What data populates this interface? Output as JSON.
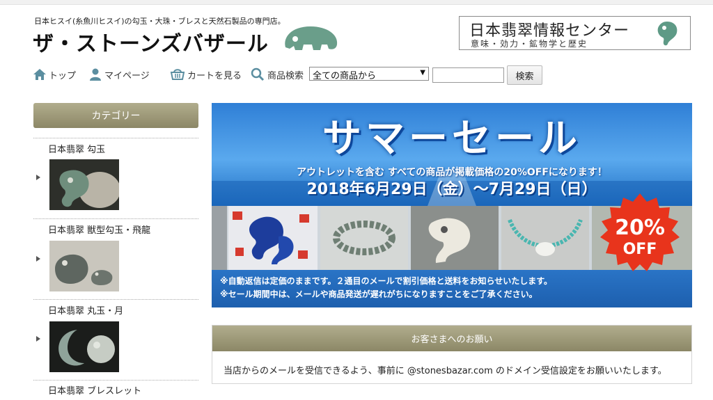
{
  "header": {
    "tagline": "日本ヒスイ(糸魚川ヒスイ)の勾玉・大珠・ブレスと天然石製品の専門店。",
    "logo_text": "ザ・ストーンズバザール",
    "info_banner": {
      "title": "日本翡翠情報センター",
      "subtitle": "意味・効力・鉱物学と歴史"
    }
  },
  "nav": {
    "items": [
      {
        "label": "トップ",
        "icon": "home-icon"
      },
      {
        "label": "マイページ",
        "icon": "user-icon"
      },
      {
        "label": "カートを見る",
        "icon": "cart-icon"
      }
    ],
    "search": {
      "label": "商品検索",
      "icon": "search-icon",
      "select_value": "全ての商品から",
      "input_value": "",
      "button_label": "検索"
    }
  },
  "sidebar": {
    "title": "カテゴリー",
    "items": [
      {
        "label": "日本翡翠 勾玉"
      },
      {
        "label": "日本翡翠 獣型勾玉・飛龍"
      },
      {
        "label": "日本翡翠 丸玉・月"
      },
      {
        "label": "日本翡翠 ブレスレット"
      }
    ]
  },
  "banner": {
    "title": "サマーセール",
    "subtitle": "アウトレットを含む すべての商品が掲載価格の20%OFFになります！",
    "date": "2018年6月29日（金）〜7月29日（日）",
    "badge_percent": "20%",
    "badge_off": "OFF",
    "notes": [
      "※自動返信は定価のままです。２通目のメールで割引価格と送料をお知らせいたします。",
      "※セール期間中は、メールや商品発送が遅れがちになりますことをご了承ください。"
    ]
  },
  "notice": {
    "title": "お客さまへのお願い",
    "body": "当店からのメールを受信できるよう、事前に @stonesbazar.com のドメイン受信設定をお願いいたします。"
  },
  "colors": {
    "accent_olive": "#9a9676",
    "sale_red": "#e8341c",
    "sale_blue": "#2a74c6",
    "jade_green": "#6a9e8a"
  }
}
